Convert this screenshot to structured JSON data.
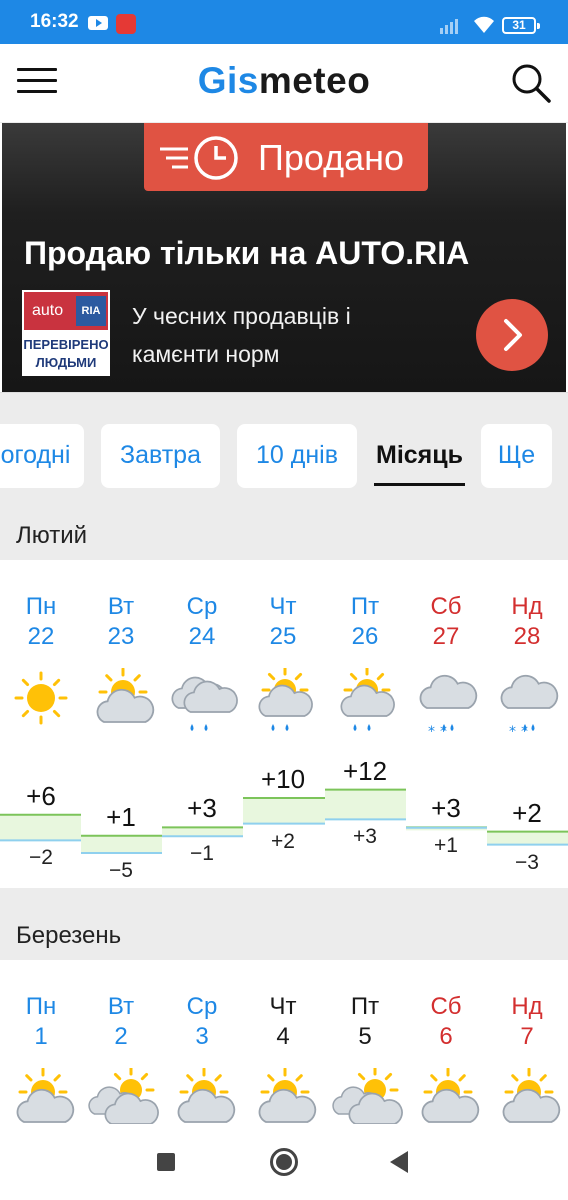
{
  "status_bar": {
    "time": "16:32",
    "battery": "31"
  },
  "header": {
    "logo_part1": "Gis",
    "logo_part2": "meteo"
  },
  "ad": {
    "badge": "Продано",
    "title": "Продаю тільки на AUTO.RIA",
    "logo_auto": "auto",
    "logo_ria": "RIA",
    "logo_line1": "ПЕРЕВІРЕНО",
    "logo_line2": "ЛЮДЬМИ",
    "text": "У чесних продавців і камєнти норм"
  },
  "tabs": [
    {
      "label": "Сьогодні"
    },
    {
      "label": "Завтра"
    },
    {
      "label": "10 днів"
    },
    {
      "label": "Місяць"
    },
    {
      "label": "Ще"
    }
  ],
  "months": [
    {
      "title": "Лютий",
      "days": [
        {
          "name": "Пн",
          "num": "22",
          "color": "blue",
          "icon": "sun-icon",
          "max": "+6",
          "min": "−2"
        },
        {
          "name": "Вт",
          "num": "23",
          "color": "blue",
          "icon": "partly-cloudy-icon",
          "max": "+1",
          "min": "−5"
        },
        {
          "name": "Ср",
          "num": "24",
          "color": "blue",
          "icon": "cloud-rain-icon",
          "max": "+3",
          "min": "−1"
        },
        {
          "name": "Чт",
          "num": "25",
          "color": "blue",
          "icon": "partly-cloudy-rain-icon",
          "max": "+10",
          "min": "+2"
        },
        {
          "name": "Пт",
          "num": "26",
          "color": "blue",
          "icon": "partly-cloudy-rain-icon",
          "max": "+12",
          "min": "+3"
        },
        {
          "name": "Сб",
          "num": "27",
          "color": "red",
          "icon": "cloud-sleet-icon",
          "max": "+3",
          "min": "+1"
        },
        {
          "name": "Нд",
          "num": "28",
          "color": "red",
          "icon": "cloud-sleet-icon",
          "max": "+2",
          "min": "−3"
        }
      ]
    },
    {
      "title": "Березень",
      "days": [
        {
          "name": "Пн",
          "num": "1",
          "color": "blue",
          "icon": "partly-cloudy-icon"
        },
        {
          "name": "Вт",
          "num": "2",
          "color": "blue",
          "icon": "cloudy-sun-icon"
        },
        {
          "name": "Ср",
          "num": "3",
          "color": "blue",
          "icon": "partly-cloudy-icon"
        },
        {
          "name": "Чт",
          "num": "4",
          "color": "dark",
          "icon": "partly-cloudy-icon"
        },
        {
          "name": "Пт",
          "num": "5",
          "color": "dark",
          "icon": "cloudy-sun-icon"
        },
        {
          "name": "Сб",
          "num": "6",
          "color": "red",
          "icon": "partly-cloudy-icon"
        },
        {
          "name": "Нд",
          "num": "7",
          "color": "red",
          "icon": "partly-cloudy-icon"
        }
      ]
    }
  ],
  "colors": {
    "accent": "#1e88e5",
    "weekend": "#d32f2f",
    "ad_red": "#e05343"
  }
}
